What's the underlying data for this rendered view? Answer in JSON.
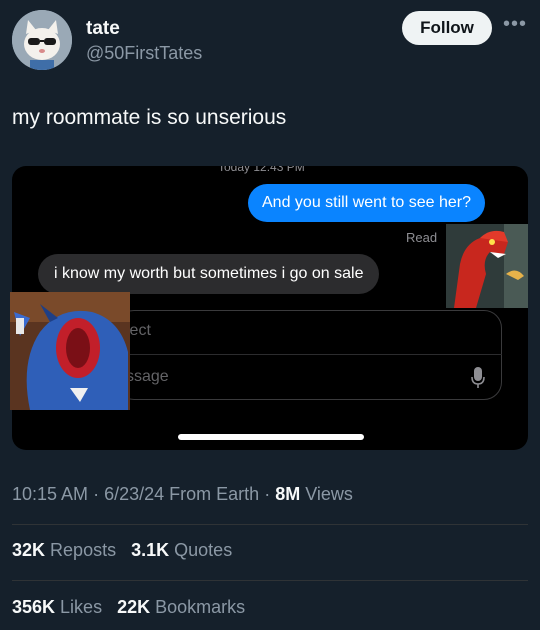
{
  "author": {
    "name": "tate",
    "handle": "@50FirstTates",
    "avatar_icon": "cat-with-sunglasses-avatar"
  },
  "follow_label": "Follow",
  "more_icon": "more-dots-icon",
  "tweet": {
    "text": "my roommate is so unserious"
  },
  "screenshot": {
    "header_fragment": "Today 12:43 PM",
    "outgoing_message": "And you still went to see her?",
    "read_label": "Read",
    "incoming_message": "i know my worth but sometimes i go on sale",
    "subject_placeholder": "ject",
    "message_placeholder": "ssage",
    "mic_icon": "microphone-icon",
    "colors": {
      "outgoing_bubble": "#0a84ff",
      "incoming_bubble": "#2c2c2e"
    }
  },
  "meta": {
    "time": "10:15 AM",
    "date": "6/23/24",
    "source": "From Earth",
    "views_count": "8M",
    "views_label": "Views"
  },
  "stats": {
    "reposts_count": "32K",
    "reposts_label": "Reposts",
    "quotes_count": "3.1K",
    "quotes_label": "Quotes",
    "likes_count": "356K",
    "likes_label": "Likes",
    "bookmarks_count": "22K",
    "bookmarks_label": "Bookmarks"
  },
  "colors": {
    "background": "#15202b",
    "text_primary": "#f7f9f9",
    "text_secondary": "#8b98a5"
  }
}
